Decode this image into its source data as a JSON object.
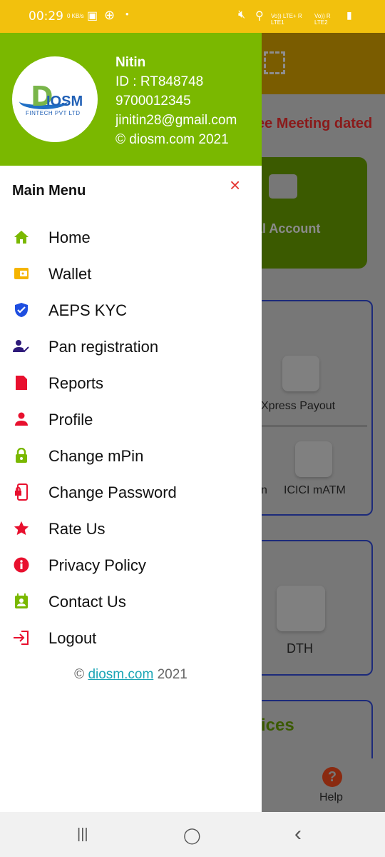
{
  "status_bar": {
    "time": "00:29",
    "net_speed": "0 KB/s",
    "carrier1": "Vo)) LTE+ R LTE1",
    "carrier2": "Vo)) R LTE2"
  },
  "background": {
    "notice": "ee Meeting dated",
    "account_card": "al Account",
    "xpress_payout": "Xpress Payout",
    "partial_label": "n",
    "icici_matm": "ICICI mATM",
    "dth": "DTH",
    "services_heading": "ices",
    "help": "Help",
    "help_icon": "?"
  },
  "drawer": {
    "logo": {
      "text": "DIOSM",
      "subtitle": "FINTECH PVT LTD"
    },
    "user": {
      "name": "Nitin",
      "id": "ID : RT848748",
      "phone": "9700012345",
      "email": "jinitin28@gmail.com",
      "copyright": "© diosm.com 2021"
    },
    "menu_title": "Main Menu",
    "close_icon": "×",
    "items": [
      {
        "label": "Home",
        "icon": "home-icon",
        "color": "#7ab800"
      },
      {
        "label": "Wallet",
        "icon": "wallet-icon",
        "color": "#f5b400"
      },
      {
        "label": "AEPS KYC",
        "icon": "shield-check-icon",
        "color": "#1e4ee0"
      },
      {
        "label": "Pan registration",
        "icon": "user-check-icon",
        "color": "#2e1a7a"
      },
      {
        "label": "Reports",
        "icon": "document-icon",
        "color": "#e8102e"
      },
      {
        "label": "Profile",
        "icon": "person-icon",
        "color": "#e8102e"
      },
      {
        "label": "Change mPin",
        "icon": "lock-icon",
        "color": "#7ab800"
      },
      {
        "label": "Change Password",
        "icon": "phone-lock-icon",
        "color": "#e8102e"
      },
      {
        "label": "Rate Us",
        "icon": "star-icon",
        "color": "#e8102e"
      },
      {
        "label": "Privacy Policy",
        "icon": "info-icon",
        "color": "#e8102e"
      },
      {
        "label": "Contact Us",
        "icon": "contact-icon",
        "color": "#7ab800"
      },
      {
        "label": "Logout",
        "icon": "logout-icon",
        "color": "#e8102e"
      }
    ],
    "footer": {
      "prefix": "© ",
      "link": "diosm.com",
      "suffix": " 2021"
    }
  },
  "navbar": {
    "recents": "|||",
    "home": "◯",
    "back": "‹"
  }
}
